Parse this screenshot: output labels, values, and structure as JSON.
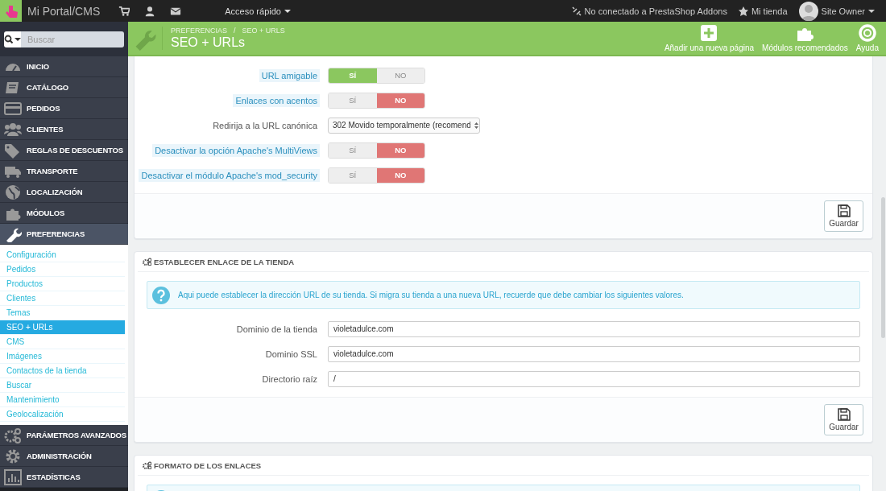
{
  "topbar": {
    "brand": "Mi Portal/CMS",
    "quick_access": "Acceso rápido",
    "addons_status": "No conectado a PrestaShop Addons",
    "shop_link": "Mi tienda",
    "user": "Site Owner"
  },
  "search": {
    "placeholder": "Buscar"
  },
  "sidebar": {
    "items": [
      {
        "label": "INICIO",
        "selected": false
      },
      {
        "label": "CATÁLOGO",
        "selected": false
      },
      {
        "label": "PEDIDOS",
        "selected": false
      },
      {
        "label": "CLIENTES",
        "selected": false
      },
      {
        "label": "REGLAS DE DESCUENTOS",
        "selected": false
      },
      {
        "label": "TRANSPORTE",
        "selected": false
      },
      {
        "label": "LOCALIZACIÓN",
        "selected": false
      },
      {
        "label": "MÓDULOS",
        "selected": false
      },
      {
        "label": "PREFERENCIAS",
        "selected": true,
        "expanded": true,
        "children": [
          {
            "label": "Configuración",
            "selected": false
          },
          {
            "label": "Pedidos",
            "selected": false
          },
          {
            "label": "Productos",
            "selected": false
          },
          {
            "label": "Clientes",
            "selected": false
          },
          {
            "label": "Temas",
            "selected": false
          },
          {
            "label": "SEO + URLs",
            "selected": true
          },
          {
            "label": "CMS",
            "selected": false
          },
          {
            "label": "Imágenes",
            "selected": false
          },
          {
            "label": "Contactos de la tienda",
            "selected": false
          },
          {
            "label": "Buscar",
            "selected": false
          },
          {
            "label": "Mantenimiento",
            "selected": false
          },
          {
            "label": "Geolocalización",
            "selected": false
          }
        ]
      },
      {
        "label": "PARÁMETROS AVANZADOS",
        "selected": false
      },
      {
        "label": "ADMINISTRACIÓN",
        "selected": false
      },
      {
        "label": "ESTADÍSTICAS",
        "selected": false
      }
    ]
  },
  "header": {
    "breadcrumb": [
      "PREFERENCIAS",
      "SEO + URLS"
    ],
    "breadcrumb_separator": "/",
    "title": "SEO + URLs",
    "toolbar": [
      {
        "label": "Añadir una nueva página"
      },
      {
        "label": "Módulos recomendados"
      },
      {
        "label": "Ayuda"
      }
    ]
  },
  "panels": [
    {
      "fields": [
        {
          "kind": "switch",
          "label": "URL amigable",
          "help": true,
          "yes": "SÍ",
          "no": "NO",
          "on": true
        },
        {
          "kind": "switch",
          "label": "Enlaces con acentos",
          "help": true,
          "yes": "SÍ",
          "no": "NO",
          "on": false
        },
        {
          "kind": "select",
          "label": "Redirija a la URL canónica",
          "help": false,
          "value": "302 Movido temporalmente (recomend"
        },
        {
          "kind": "switch",
          "label": "Desactivar la opción Apache's MultiViews",
          "help": true,
          "yes": "SÍ",
          "no": "NO",
          "on": false
        },
        {
          "kind": "switch",
          "label": "Desactivar el módulo Apache's mod_security",
          "help": true,
          "yes": "SÍ",
          "no": "NO",
          "on": false
        }
      ],
      "save_button": "Guardar"
    },
    {
      "title": "ESTABLECER ENLACE DE LA TIENDA",
      "info": "Aqui puede establecer la dirección URL de su tienda. Si migra su tienda a una nueva URL, recuerde que debe cambiar los siguientes valores.",
      "fields": [
        {
          "kind": "text",
          "label": "Dominio de la tienda",
          "help": false,
          "value": "violetadulce.com"
        },
        {
          "kind": "text",
          "label": "Dominio SSL",
          "help": false,
          "value": "violetadulce.com"
        },
        {
          "kind": "text",
          "label": "Directorio raíz",
          "help": false,
          "value": "/"
        }
      ],
      "save_button": "Guardar"
    },
    {
      "title": "FORMATO DE LOS ENLACES",
      "info_box": true
    }
  ]
}
